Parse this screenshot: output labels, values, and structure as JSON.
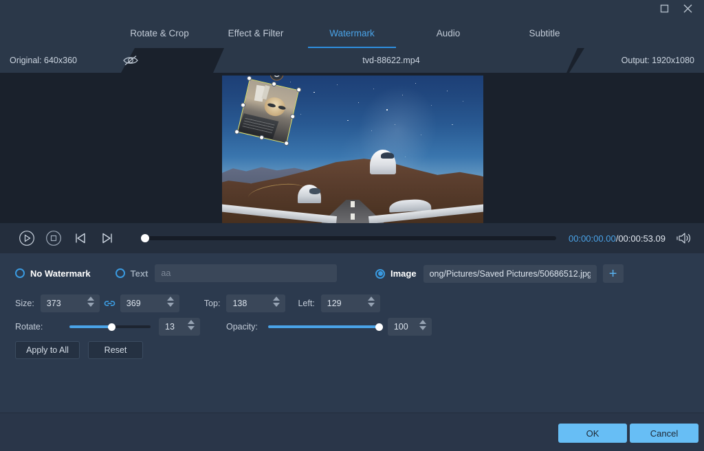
{
  "window": {
    "maximize_icon": "maximize-icon",
    "close_icon": "close-icon"
  },
  "tabs": [
    {
      "label": "Rotate & Crop",
      "active": false
    },
    {
      "label": "Effect & Filter",
      "active": false
    },
    {
      "label": "Watermark",
      "active": true
    },
    {
      "label": "Audio",
      "active": false
    },
    {
      "label": "Subtitle",
      "active": false
    }
  ],
  "info": {
    "original": "Original: 640x360",
    "eye_icon": "eye-off-icon",
    "filename": "tvd-88622.mp4",
    "output": "Output: 1920x1080"
  },
  "player": {
    "play_icon": "play-icon",
    "stop_icon": "stop-icon",
    "prev_icon": "previous-frame-icon",
    "next_icon": "next-frame-icon",
    "volume_icon": "volume-icon",
    "current_time": "00:00:00.00",
    "separator": "/",
    "total_time": "00:00:53.09",
    "progress_percent": 0
  },
  "watermark": {
    "none": {
      "label": "No Watermark",
      "selected": false
    },
    "text": {
      "label": "Text",
      "selected": false,
      "value": "",
      "placeholder": "aa"
    },
    "image": {
      "label": "Image",
      "selected": true,
      "path": "ong/Pictures/Saved Pictures/50686512.jpg",
      "add_label": "+"
    },
    "size": {
      "label": "Size:",
      "width": "373",
      "height": "369",
      "link_icon": "link-icon",
      "linked": true
    },
    "top": {
      "label": "Top:",
      "value": "138"
    },
    "left": {
      "label": "Left:",
      "value": "129"
    },
    "rotate": {
      "label": "Rotate:",
      "value": "13",
      "percent": 52
    },
    "opacity": {
      "label": "Opacity:",
      "value": "100",
      "percent": 100
    },
    "apply_all_label": "Apply to All",
    "reset_label": "Reset"
  },
  "footer": {
    "ok_label": "OK",
    "cancel_label": "Cancel"
  },
  "colors": {
    "accent": "#4aa3e8",
    "primary_button": "#67bef5",
    "panel_bg": "#2c3a4e",
    "titlebar_bg": "#2b3849",
    "preview_bg": "#1a212c",
    "field_bg": "#3a4759",
    "watermark_outline": "#e3e36a"
  }
}
